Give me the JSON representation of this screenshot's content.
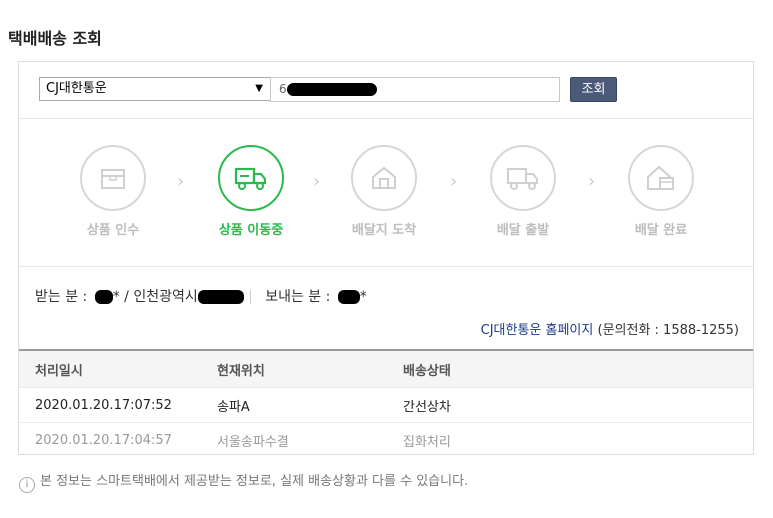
{
  "page": {
    "title": "택배배송 조회"
  },
  "search": {
    "carrier_selected": "CJ대한통운",
    "tracking_value": "6",
    "button_label": "조회"
  },
  "steps": [
    {
      "label": "상품 인수",
      "icon": "box-icon",
      "active": false
    },
    {
      "label": "상품 이동중",
      "icon": "truck-icon",
      "active": true
    },
    {
      "label": "배달지 도착",
      "icon": "house-icon",
      "active": false
    },
    {
      "label": "배달 출발",
      "icon": "delivery-truck-icon",
      "active": false
    },
    {
      "label": "배달 완료",
      "icon": "house-package-icon",
      "active": false
    }
  ],
  "info": {
    "recipient_label": "받는 분 :",
    "recipient_name_suffix": "*",
    "recipient_region": "/ 인천광역시",
    "sender_label": "보내는 분 :",
    "sender_name_suffix": "*",
    "carrier_homepage": "CJ대한통운 홈페이지",
    "phone_text": "(문의전화 : 1588-1255)"
  },
  "history": {
    "columns": [
      "처리일시",
      "현재위치",
      "배송상태"
    ],
    "rows": [
      {
        "time": "2020.01.20.17:07:52",
        "location": "송파A",
        "status": "간선상차"
      },
      {
        "time": "2020.01.20.17:04:57",
        "location": "서울송파수결",
        "status": "집화처리"
      }
    ]
  },
  "footnote": {
    "text": "본 정보는 스마트택배에서 제공받는 정보로, 실제 배송상황과 다를 수 있습니다."
  },
  "colors": {
    "active_green": "#2cb84a",
    "button_navy": "#4b5a78"
  }
}
